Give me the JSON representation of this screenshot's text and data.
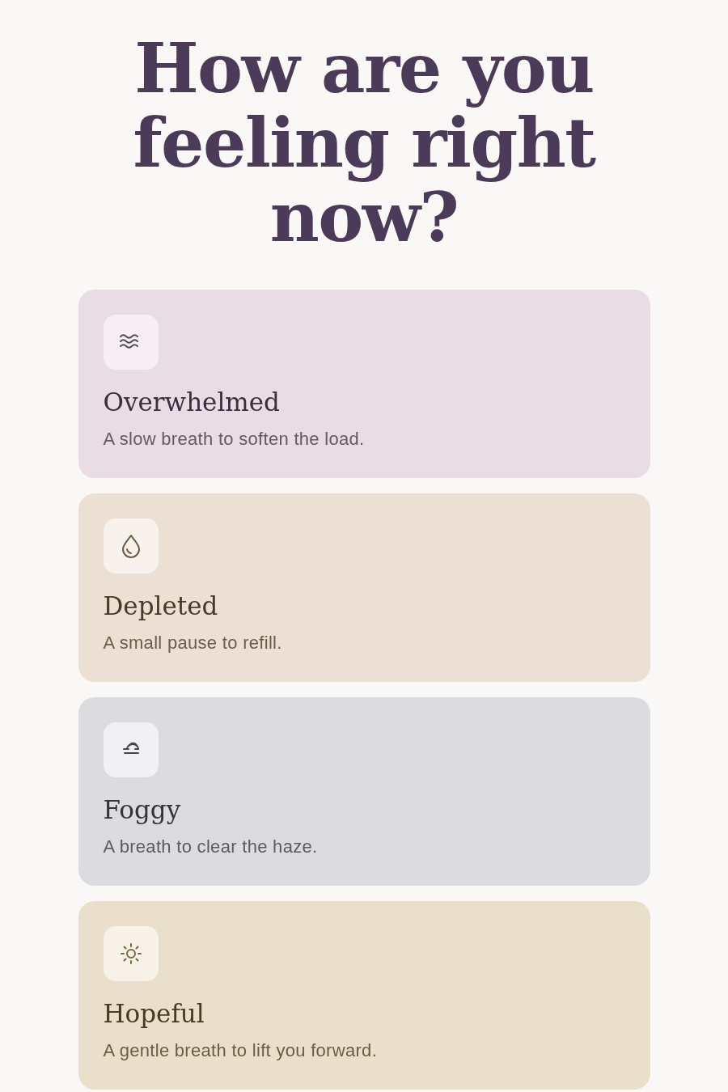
{
  "heading": "How are you feeling right now?",
  "moods": [
    {
      "kind": "waves",
      "color": "#e8dde5",
      "title": "Overwhelmed",
      "description": "A slow breath to soften the load."
    },
    {
      "kind": "drop",
      "color": "#ebe0d3",
      "title": "Depleted",
      "description": "A small pause to refill."
    },
    {
      "kind": "fog",
      "color": "#dcdce0",
      "title": "Foggy",
      "description": "A breath to clear the haze."
    },
    {
      "kind": "sun",
      "color": "#eadfcb",
      "title": "Hopeful",
      "description": "A gentle breath to lift you forward."
    }
  ]
}
